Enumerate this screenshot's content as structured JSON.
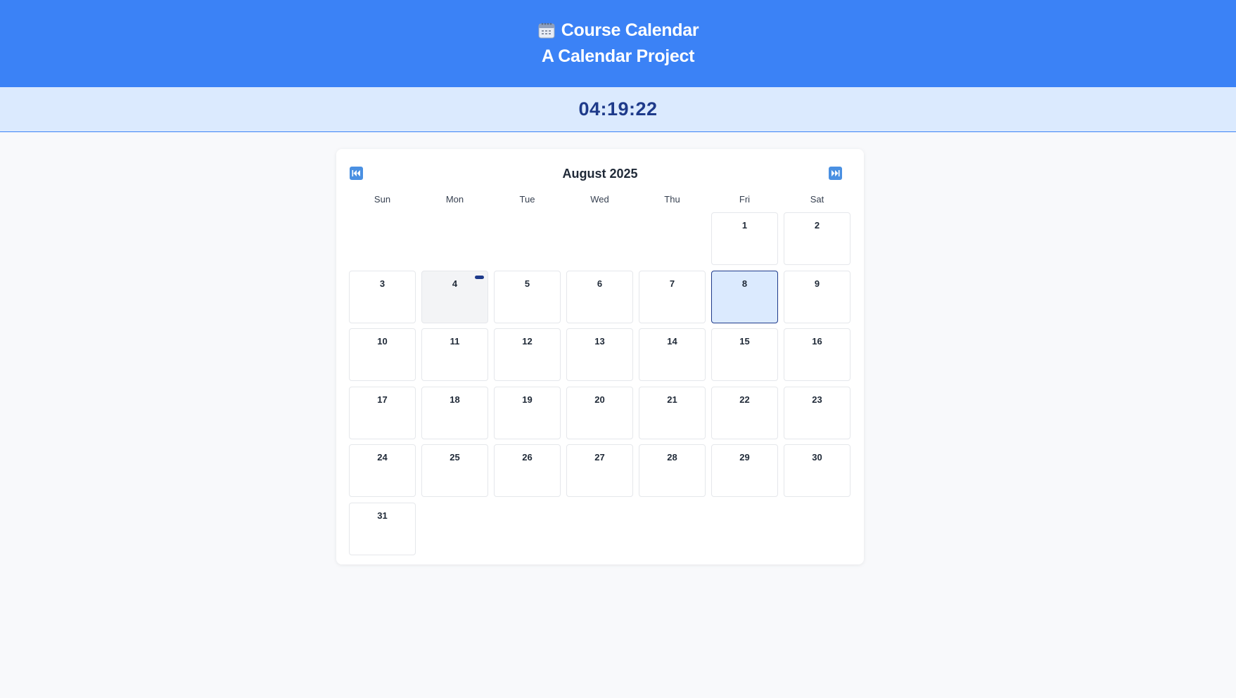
{
  "header": {
    "title": "Course Calendar",
    "subtitle": "A Calendar Project",
    "icon": "calendar-icon"
  },
  "clock": {
    "time": "04:19:22"
  },
  "calendar": {
    "month_title": "August 2025",
    "prev_icon": "rewind-icon",
    "next_icon": "fast-forward-icon",
    "weekdays": [
      "Sun",
      "Mon",
      "Tue",
      "Wed",
      "Thu",
      "Fri",
      "Sat"
    ],
    "leading_blank_days": 5,
    "days": [
      "1",
      "2",
      "3",
      "4",
      "5",
      "6",
      "7",
      "8",
      "9",
      "10",
      "11",
      "12",
      "13",
      "14",
      "15",
      "16",
      "17",
      "18",
      "19",
      "20",
      "21",
      "22",
      "23",
      "24",
      "25",
      "26",
      "27",
      "28",
      "29",
      "30",
      "31"
    ],
    "today": "8",
    "event_days": [
      "4"
    ]
  },
  "colors": {
    "header_bg": "#3b82f6",
    "clock_bg": "#dbeafe",
    "clock_text": "#1e3a8a",
    "today_bg": "#dbeafe",
    "event_marker": "#1e3a8a",
    "nav_button": "#4a90e2"
  }
}
